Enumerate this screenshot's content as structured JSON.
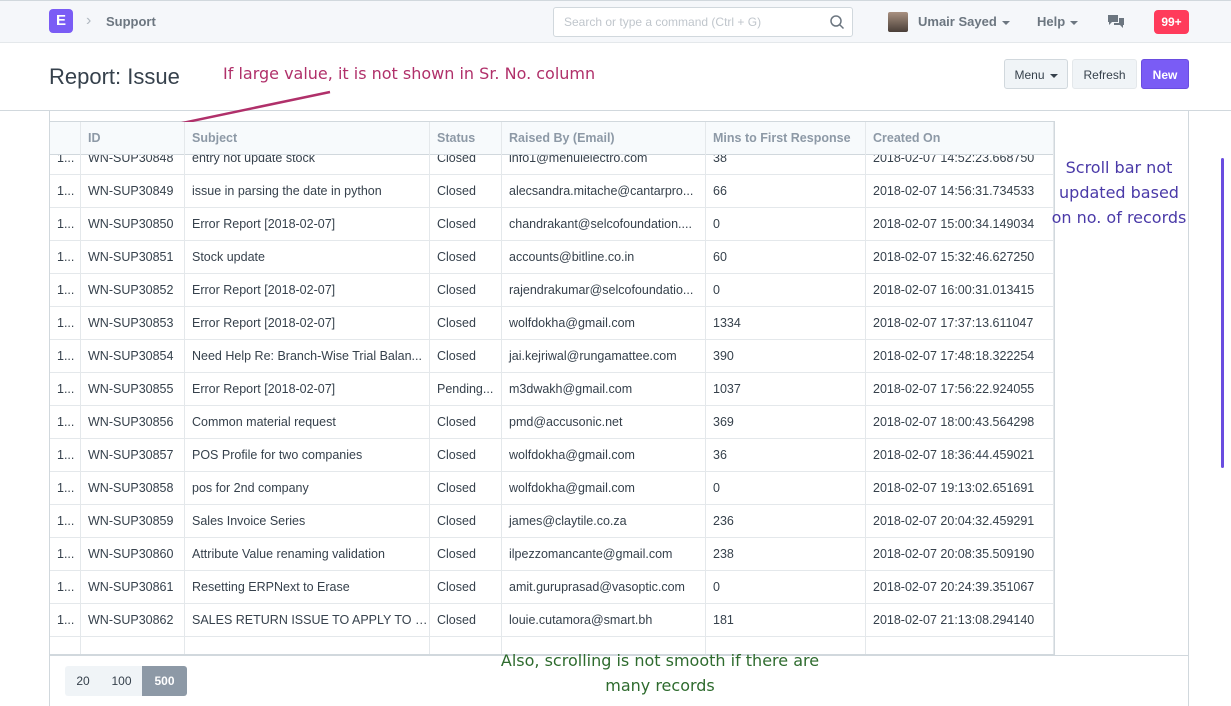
{
  "navbar": {
    "logo": "E",
    "breadcrumb": "Support",
    "search_placeholder": "Search or type a command (Ctrl + G)",
    "user_name": "Umair Sayed",
    "help": "Help",
    "notifications": "99+"
  },
  "page": {
    "title": "Report: Issue",
    "menu_label": "Menu",
    "refresh_label": "Refresh",
    "new_label": "New"
  },
  "table": {
    "columns": [
      "",
      "ID",
      "Subject",
      "Status",
      "Raised By (Email)",
      "Mins to First Response",
      "Created On"
    ],
    "rows": [
      [
        "1...",
        "WN-SUP30848",
        "entry not update stock",
        "Closed",
        "info1@mehulelectro.com",
        "38",
        "2018-02-07 14:52:23.668750"
      ],
      [
        "1...",
        "WN-SUP30849",
        "issue in parsing the date in python",
        "Closed",
        "alecsandra.mitache@cantarpro...",
        "66",
        "2018-02-07 14:56:31.734533"
      ],
      [
        "1...",
        "WN-SUP30850",
        "Error Report [2018-02-07]",
        "Closed",
        "chandrakant@selcofoundation....",
        "0",
        "2018-02-07 15:00:34.149034"
      ],
      [
        "1...",
        "WN-SUP30851",
        "Stock update",
        "Closed",
        "accounts@bitline.co.in",
        "60",
        "2018-02-07 15:32:46.627250"
      ],
      [
        "1...",
        "WN-SUP30852",
        "Error Report [2018-02-07]",
        "Closed",
        "rajendrakumar@selcofoundatio...",
        "0",
        "2018-02-07 16:00:31.013415"
      ],
      [
        "1...",
        "WN-SUP30853",
        "Error Report [2018-02-07]",
        "Closed",
        "wolfdokha@gmail.com",
        "1334",
        "2018-02-07 17:37:13.611047"
      ],
      [
        "1...",
        "WN-SUP30854",
        "Need Help Re: Branch-Wise Trial Balan...",
        "Closed",
        "jai.kejriwal@rungamattee.com",
        "390",
        "2018-02-07 17:48:18.322254"
      ],
      [
        "1...",
        "WN-SUP30855",
        "Error Report [2018-02-07]",
        "Pending...",
        "m3dwakh@gmail.com",
        "1037",
        "2018-02-07 17:56:22.924055"
      ],
      [
        "1...",
        "WN-SUP30856",
        "Common material request",
        "Closed",
        "pmd@accusonic.net",
        "369",
        "2018-02-07 18:00:43.564298"
      ],
      [
        "1...",
        "WN-SUP30857",
        "POS Profile for two companies",
        "Closed",
        "wolfdokha@gmail.com",
        "36",
        "2018-02-07 18:36:44.459021"
      ],
      [
        "1...",
        "WN-SUP30858",
        "pos for 2nd company",
        "Closed",
        "wolfdokha@gmail.com",
        "0",
        "2018-02-07 19:13:02.651691"
      ],
      [
        "1...",
        "WN-SUP30859",
        "Sales Invoice Series",
        "Closed",
        "james@claytile.co.za",
        "236",
        "2018-02-07 20:04:32.459291"
      ],
      [
        "1...",
        "WN-SUP30860",
        "Attribute Value renaming validation",
        "Closed",
        "ilpezzomancante@gmail.com",
        "238",
        "2018-02-07 20:08:35.509190"
      ],
      [
        "1...",
        "WN-SUP30861",
        "Resetting ERPNext to Erase",
        "Closed",
        "amit.guruprasad@vasoptic.com",
        "0",
        "2018-02-07 20:24:39.351067"
      ],
      [
        "1...",
        "WN-SUP30862",
        "SALES RETURN ISSUE TO APPLY TO S...",
        "Closed",
        "louie.cutamora@smart.bh",
        "181",
        "2018-02-07 21:13:08.294140"
      ]
    ]
  },
  "pager": {
    "options": [
      "20",
      "100",
      "500"
    ],
    "selected": "500"
  },
  "annotations": {
    "top": "If large value, it is not shown in Sr. No. column",
    "right": "Scroll bar not updated based on no. of records",
    "bottom": "Also, scrolling is not smooth if there are many records"
  },
  "colors": {
    "brand": "#7a5cf5",
    "notification": "#ff3b5b",
    "annotation_top": "#b0306a",
    "annotation_right": "#4a3aa8",
    "annotation_bottom": "#2e6b2e"
  }
}
